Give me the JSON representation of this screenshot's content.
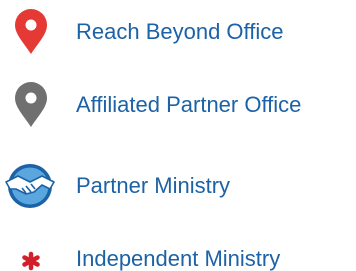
{
  "legend": {
    "items": [
      {
        "label": "Reach Beyond Office",
        "icon": "red-location-pin-icon"
      },
      {
        "label": "Affiliated Partner Office",
        "icon": "gray-location-pin-icon"
      },
      {
        "label": "Partner Ministry",
        "icon": "handshake-icon"
      },
      {
        "label": "Independent Ministry",
        "icon": "red-asterisk-icon"
      }
    ]
  },
  "colors": {
    "label_text": "#1c62a6",
    "reach_beyond_pin": "#e53935",
    "affiliated_pin": "#707070",
    "handshake_badge": "#1c62a6",
    "handshake_badge_light": "#5aa7df",
    "independent_asterisk": "#d1202a"
  }
}
